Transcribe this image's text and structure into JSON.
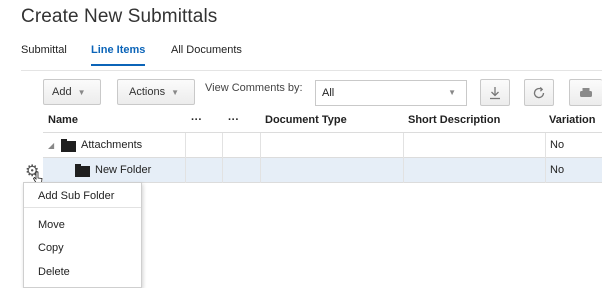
{
  "page_title": "Create New Submittals",
  "tabs": [
    {
      "label": "Submittal",
      "active": false
    },
    {
      "label": "Line Items",
      "active": true
    },
    {
      "label": "All Documents",
      "active": false
    }
  ],
  "toolbar": {
    "add_label": "Add",
    "actions_label": "Actions",
    "view_comments_label": "View Comments by:",
    "view_comments_value": "All",
    "icons": [
      "download-icon",
      "refresh-icon",
      "print-icon"
    ]
  },
  "grid": {
    "columns": [
      "Name",
      "···",
      "···",
      "Document Type",
      "Short Description",
      "Variation"
    ],
    "rows": [
      {
        "name": "Attachments",
        "variation": "No",
        "expanded": true,
        "selected": false
      },
      {
        "name": "New Folder",
        "variation": "No",
        "expanded": false,
        "selected": true
      }
    ]
  },
  "context_menu": {
    "items": [
      "Add Sub Folder",
      "Move",
      "Copy",
      "Delete"
    ]
  },
  "colors": {
    "accent": "#0b64b8",
    "selected_row": "#e6eef7"
  }
}
